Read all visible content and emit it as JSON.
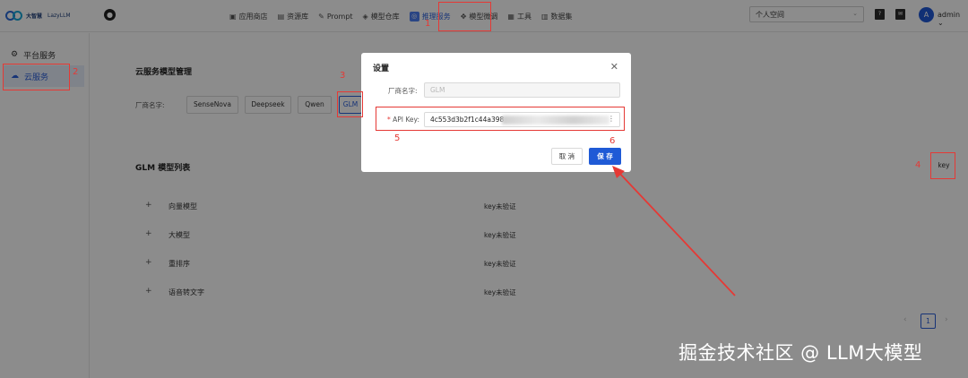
{
  "header": {
    "logo_cn": "大智慧",
    "logo_en": "LazyLLM",
    "nav": [
      {
        "label": "应用商店",
        "icon": "store-icon"
      },
      {
        "label": "资源库",
        "icon": "library-icon"
      },
      {
        "label": "Prompt",
        "icon": "prompt-icon"
      },
      {
        "label": "模型仓库",
        "icon": "model-repo-icon"
      },
      {
        "label": "推理服务",
        "icon": "inference-icon"
      },
      {
        "label": "模型微调",
        "icon": "finetune-icon"
      },
      {
        "label": "工具",
        "icon": "tools-icon"
      },
      {
        "label": "数据集",
        "icon": "dataset-icon"
      }
    ],
    "space_select": "个人空间",
    "avatar_letter": "A",
    "user": "admin"
  },
  "sidebar": {
    "items": [
      {
        "label": "平台服务",
        "icon": "gear-icon"
      },
      {
        "label": "云服务",
        "icon": "cloud-icon"
      }
    ]
  },
  "main": {
    "title": "云服务模型管理",
    "vendor_label": "厂商名字:",
    "vendors": [
      "SenseNova",
      "Deepseek",
      "Qwen",
      "GLM"
    ],
    "list_title": "GLM 模型列表",
    "key_button": "key",
    "rows": [
      {
        "name": "向量模型",
        "status": "key未验证"
      },
      {
        "name": "大模型",
        "status": "key未验证"
      },
      {
        "name": "重排序",
        "status": "key未验证"
      },
      {
        "name": "语音转文字",
        "status": "key未验证"
      }
    ],
    "page": "1"
  },
  "modal": {
    "title": "设置",
    "vendor_label": "厂商名字:",
    "vendor_value": "GLM",
    "apikey_label": "API Key:",
    "apikey_value": "4c553d3b2f1c44a398",
    "cancel": "取 消",
    "save": "保 存"
  },
  "annotations": [
    "1",
    "2",
    "3",
    "4",
    "5",
    "6"
  ],
  "watermark": "掘金技术社区 @ LLM大模型",
  "colors": {
    "accent": "#1f5ad6",
    "annotation": "#e53935"
  }
}
